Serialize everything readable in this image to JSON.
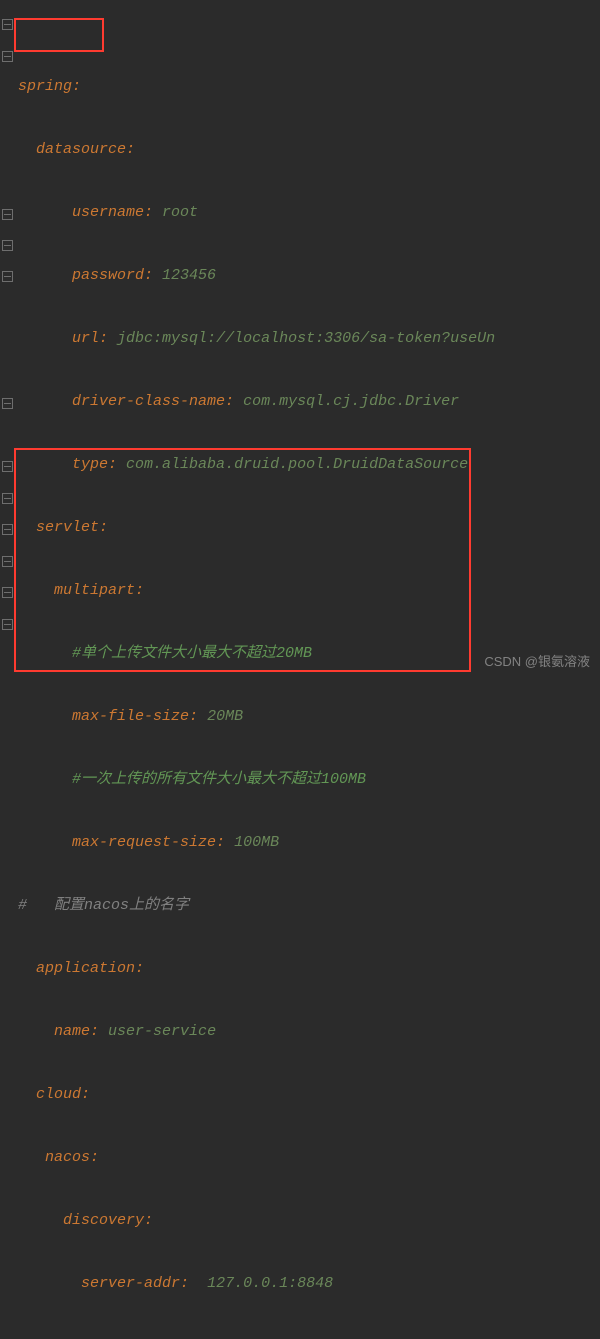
{
  "code": {
    "l1_key": "spring",
    "l2_key": "datasource",
    "l3_key": "username",
    "l3_val": "root",
    "l4_key": "password",
    "l4_val": "123456",
    "l5_key": "url",
    "l5_val": "jdbc:mysql://localhost:3306/sa-token?useUn",
    "l6_key": "driver-class-name",
    "l6_val": "com.mysql.cj.jdbc.Driver",
    "l7_key": "type",
    "l7_val": "com.alibaba.druid.pool.DruidDataSource",
    "l8_key": "servlet",
    "l9_key": "multipart",
    "l10_comment": "#单个上传文件大小最大不超过20MB",
    "l11_key": "max-file-size",
    "l11_val": "20MB",
    "l12_comment": "#一次上传的所有文件大小最大不超过100MB",
    "l13_key": "max-request-size",
    "l13_val": "100MB",
    "l14_comment": "#   配置nacos上的名字",
    "l15_key": "application",
    "l16_key": "name",
    "l16_val": "user-service",
    "l17_key": "cloud",
    "l18_key": "nacos",
    "l19_key": "discovery",
    "l20_key": "server-addr",
    "l20_val": "127.0.0.1:8848"
  },
  "watermark": "CSDN @银氨溶液"
}
